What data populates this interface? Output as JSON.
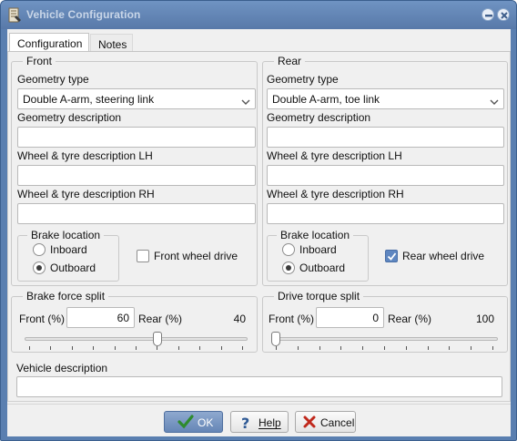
{
  "window": {
    "title": "Vehicle Configuration",
    "controls": [
      "minimize-icon",
      "close-icon"
    ]
  },
  "tabs": [
    {
      "label": "Configuration",
      "active": true
    },
    {
      "label": "Notes",
      "active": false
    }
  ],
  "front": {
    "legend": "Front",
    "geometry_type_label": "Geometry type",
    "geometry_type_value": "Double A-arm, steering link",
    "geometry_description_label": "Geometry description",
    "geometry_description_value": "",
    "wheel_lh_label": "Wheel & tyre description LH",
    "wheel_lh_value": "",
    "wheel_rh_label": "Wheel & tyre description RH",
    "wheel_rh_value": "",
    "brake_location_legend": "Brake location",
    "brake_inboard_label": "Inboard",
    "brake_outboard_label": "Outboard",
    "brake_location_selected": "Outboard",
    "drive_label": "Front wheel drive",
    "drive_checked": false
  },
  "rear": {
    "legend": "Rear",
    "geometry_type_label": "Geometry type",
    "geometry_type_value": "Double A-arm, toe link",
    "geometry_description_label": "Geometry description",
    "geometry_description_value": "",
    "wheel_lh_label": "Wheel & tyre description LH",
    "wheel_lh_value": "",
    "wheel_rh_label": "Wheel & tyre description RH",
    "wheel_rh_value": "",
    "brake_location_legend": "Brake location",
    "brake_inboard_label": "Inboard",
    "brake_outboard_label": "Outboard",
    "brake_location_selected": "Outboard",
    "drive_label": "Rear wheel drive",
    "drive_checked": true
  },
  "brake_force_split": {
    "legend": "Brake force split",
    "front_label": "Front (%)",
    "front_value": "60",
    "rear_label": "Rear (%)",
    "rear_value": "40",
    "slider_fraction": 0.6
  },
  "drive_torque_split": {
    "legend": "Drive torque split",
    "front_label": "Front (%)",
    "front_value": "0",
    "rear_label": "Rear (%)",
    "rear_value": "100",
    "slider_fraction": 0.0
  },
  "vehicle_description": {
    "label": "Vehicle description",
    "value": ""
  },
  "buttons": {
    "ok": "OK",
    "help": "Help",
    "help_underline": "H",
    "cancel": "Cancel"
  },
  "colors": {
    "title_bar": "#5a7fb0",
    "checkbox_checked": "#5e86c0",
    "ok_check": "#2e8b2e",
    "cancel_x": "#c0281c"
  }
}
